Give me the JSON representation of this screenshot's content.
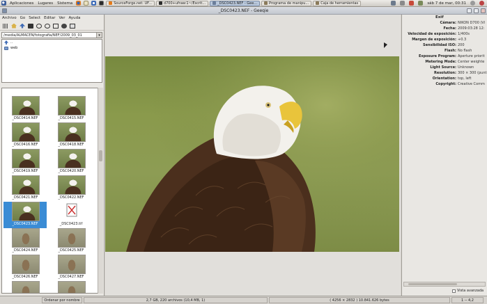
{
  "taskbar": {
    "menus": [
      "Aplicaciones",
      "Lugares",
      "Sistema"
    ],
    "tasks": [
      {
        "label": "SourceForge.net: UF..."
      },
      {
        "label": "d700+ufraw:1~/Escrit..."
      },
      {
        "label": "_DSC0423.NEF - Gee..."
      },
      {
        "label": "Programa de manipu..."
      },
      {
        "label": "Caja de herramientas"
      }
    ],
    "clock": "sáb  7 de mar, 00:31"
  },
  "window": {
    "title": "_DSC0423.NEF - Geeqie"
  },
  "menubar": [
    "Archivo",
    "Go",
    "Select",
    "Editar",
    "Ver",
    "Ayuda"
  ],
  "path": "/media/ALMACEN/fotografia/NEF/2009_03_01",
  "dirs": [
    {
      "name": ".."
    },
    {
      "name": "web"
    }
  ],
  "thumbs": [
    {
      "name": "_DSC0414.NEF",
      "kind": "eagle"
    },
    {
      "name": "_DSC0415.NEF",
      "kind": "eagle"
    },
    {
      "name": "_DSC0416.NEF",
      "kind": "eagle"
    },
    {
      "name": "_DSC0418.NEF",
      "kind": "eagle"
    },
    {
      "name": "_DSC0419.NEF",
      "kind": "eagle"
    },
    {
      "name": "_DSC0420.NEF",
      "kind": "eagle"
    },
    {
      "name": "_DSC0421.NEF",
      "kind": "eagle"
    },
    {
      "name": "_DSC0422.NEF",
      "kind": "eagle"
    },
    {
      "name": "_DSC0423.NEF",
      "kind": "eagle",
      "selected": true
    },
    {
      "name": "_DSC0423.tif",
      "kind": "broken"
    },
    {
      "name": "_DSC0424.NEF",
      "kind": "owl"
    },
    {
      "name": "_DSC0425.NEF",
      "kind": "owl"
    },
    {
      "name": "_DSC0426.NEF",
      "kind": "owl"
    },
    {
      "name": "_DSC0427.NEF",
      "kind": "owl"
    },
    {
      "name": "_DSC0428.NEF",
      "kind": "owl"
    },
    {
      "name": "_DSC0429.NEF",
      "kind": "owl"
    }
  ],
  "exif": {
    "header": "Exif",
    "rows": [
      {
        "k": "Cámara:",
        "v": "NIKON D700 (Vi"
      },
      {
        "k": "Fecha:",
        "v": "2009:03:28 12:"
      },
      {
        "k": "Velocidad de exposición:",
        "v": "1/400s"
      },
      {
        "k": "Margen de exposición:",
        "v": "+0.3"
      },
      {
        "k": "Sensibilidad ISO:",
        "v": "200"
      },
      {
        "k": "Flash:",
        "v": "No flash"
      },
      {
        "k": "Exposure Program:",
        "v": "Aperture priorit"
      },
      {
        "k": "Metering Mode:",
        "v": "Center weighte"
      },
      {
        "k": "Light Source:",
        "v": "Unknown"
      },
      {
        "k": "Resolution:",
        "v": "300 × 300 (punt"
      },
      {
        "k": "Orientation:",
        "v": "top, left"
      },
      {
        "k": "Copyright:",
        "v": "Creative Comm"
      }
    ],
    "vista_avanzada": "Vista avanzada"
  },
  "status": {
    "sort": "Ordenar por nombre",
    "count": "2,7 GB, 220 archivos (10,4 MB, 1)",
    "dims": "( 4256 × 2832 ) 10.841.626 bytes",
    "zoom": "1 -- 4,2"
  },
  "colors": {
    "selection": "#3a8cd5",
    "grass": "#8a9a4c"
  }
}
